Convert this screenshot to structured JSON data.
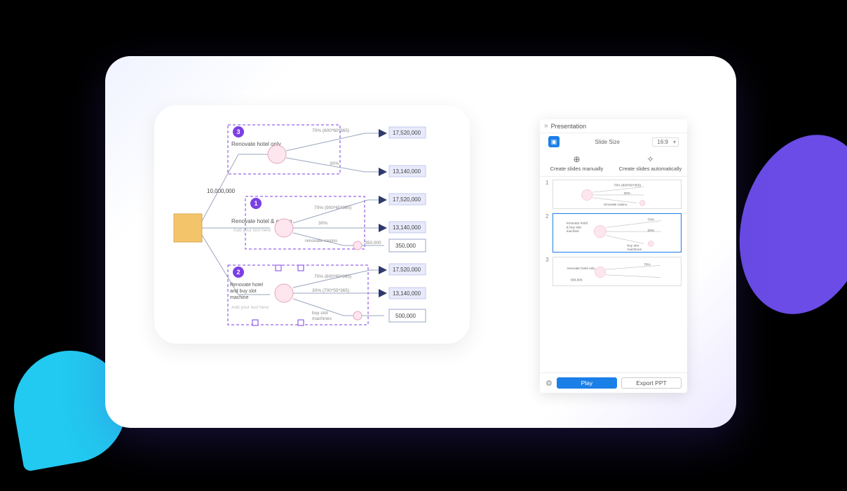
{
  "diagram": {
    "root_label": "10,000,000",
    "branches": [
      {
        "badge": "3",
        "label": "Renovate hotel only",
        "split_top": "70% (800*60*365)",
        "split_bot": "30%",
        "out_top": "17,520,000",
        "out_bot": "13,140,000"
      },
      {
        "badge": "1",
        "label": "Renovate hotel & casino",
        "hint": "Add your text here",
        "sub_label": "renovate casino",
        "split_top": "70% (900*60*365)",
        "split_bot": "30%",
        "out_top": "17,520,000",
        "out_mid": "13,140,000",
        "out_last_val": "350,000",
        "out_last_prefix": "-350,000"
      },
      {
        "badge": "2",
        "label": "Renovate hotel and buy slot machine",
        "hint": "Add your text here",
        "sub_label": "buy slot machines",
        "split_top": "70% (800*60*365)",
        "split_bot": "30% (700*55*365)",
        "out_top": "17,520,000",
        "out_mid": "13,140,000",
        "out_last_val": "500,000"
      }
    ]
  },
  "presentation": {
    "title": "Presentation",
    "slide_size_label": "Slide Size",
    "slide_size_value": "16:9",
    "create_manual": "Create slides manually",
    "create_auto": "Create slides automatically",
    "slides": [
      {
        "num": "1",
        "lines": [
          "70% (800*60*365)",
          "30%",
          "renovate casino"
        ]
      },
      {
        "num": "2",
        "lines": [
          "renovate hotel & buy slot machine",
          "70%",
          "30%",
          "buy slot machines"
        ]
      },
      {
        "num": "3",
        "lines": [
          "renovate hotel only",
          "70%",
          "300,000"
        ]
      }
    ],
    "play": "Play",
    "export": "Export PPT"
  }
}
